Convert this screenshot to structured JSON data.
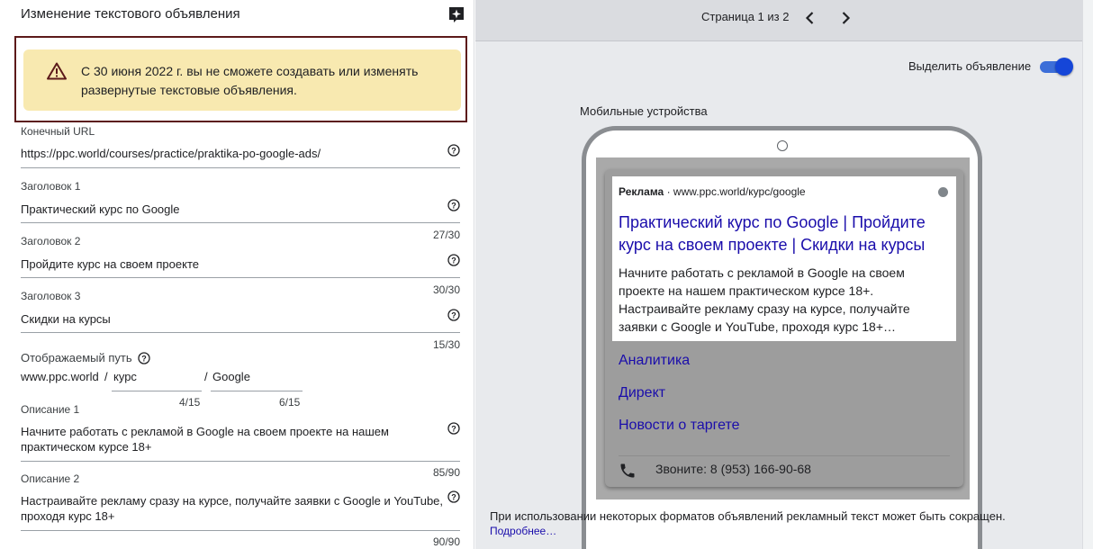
{
  "editor": {
    "title": "Изменение текстового объявления",
    "warning": "С 30 июня 2022 г. вы не сможете создавать или изменять развернутые текстовые объявления.",
    "final_url": {
      "label": "Конечный URL",
      "value": "https://ppc.world/courses/practice/praktika-po-google-ads/"
    },
    "headline1": {
      "label": "Заголовок 1",
      "value": "Практический курс по Google",
      "counter": "27/30"
    },
    "headline2": {
      "label": "Заголовок 2",
      "value": "Пройдите курс на своем проекте",
      "counter": "30/30"
    },
    "headline3": {
      "label": "Заголовок 3",
      "value": "Скидки на курсы",
      "counter": "15/30"
    },
    "display_path": {
      "label": "Отображаемый путь",
      "domain": "www.ppc.world",
      "sep1": "/",
      "path1": "курс",
      "path1_counter": "4/15",
      "sep2": "/",
      "path2": "Google",
      "path2_counter": "6/15"
    },
    "description1": {
      "label": "Описание 1",
      "value": "Начните работать с рекламой в Google на своем проекте на нашем практическом курсе 18+",
      "counter": "85/90"
    },
    "description2": {
      "label": "Описание 2",
      "value": "Настраивайте рекламу сразу на курсе, получайте заявки с Google и YouTube, проходя курс 18+",
      "counter": "90/90"
    }
  },
  "preview": {
    "page_label": "Страница 1 из 2",
    "highlight_label": "Выделить объявление",
    "highlight_on": true,
    "devices_label": "Мобильные устройства",
    "ad": {
      "badge": "Реклама",
      "dot": "·",
      "url": "www.ppc.world/курс/google",
      "title": "Практический курс по Google | Пройдите курс на своем проекте | Скидки на курсы",
      "description": "Начните работать с рекламой в Google на своем проекте на нашем практическом курсе 18+. Настраивайте рекламу сразу на курсе, получайте заявки с Google и YouTube, проходя курс 18+…",
      "sitelinks": [
        "Аналитика",
        "Директ",
        "Новости о таргете"
      ],
      "call": "Звоните: 8 (953) 166-90-68"
    },
    "note": "При использовании некоторых форматов объявлений рекламный текст может быть сокращен.",
    "note_link": "Подробнее…"
  },
  "colors": {
    "warning_bg": "#f8e9b0",
    "link": "#1a0dab",
    "toggle": "#1546d8"
  }
}
